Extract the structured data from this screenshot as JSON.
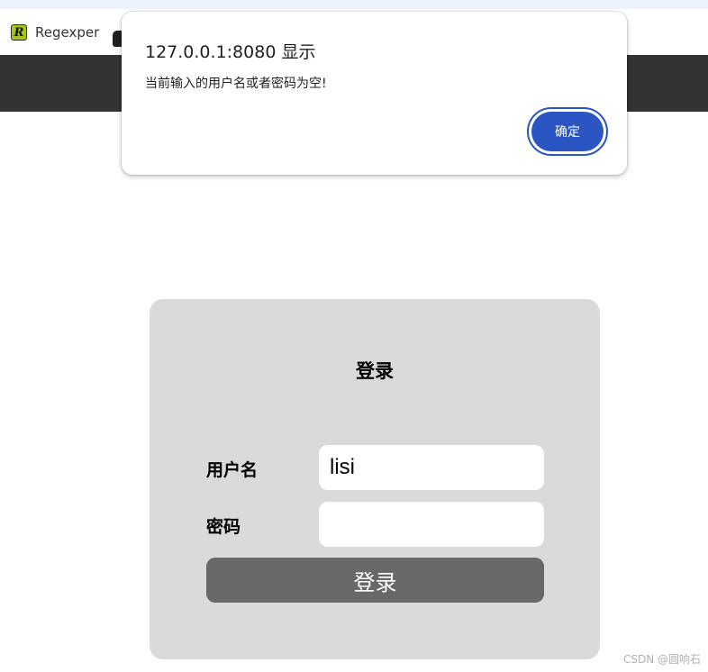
{
  "browser": {
    "bookmarks": [
      {
        "label": "Regexper",
        "icon": "regexper-favicon",
        "icon_letter": "R"
      },
      {
        "label": "",
        "icon": "second-favicon"
      }
    ]
  },
  "alert_dialog": {
    "title": "127.0.0.1:8080 显示",
    "message": "当前输入的用户名或者密码为空!",
    "ok_label": "确定",
    "accent_color": "#2a55c2"
  },
  "login_form": {
    "title": "登录",
    "username_label": "用户名",
    "username_value": "lisi",
    "password_label": "密码",
    "password_value": "",
    "submit_label": "登录"
  },
  "colors": {
    "navbar": "#333333",
    "card": "#dadada",
    "button": "#686868"
  },
  "watermark": "CSDN @圆响石"
}
